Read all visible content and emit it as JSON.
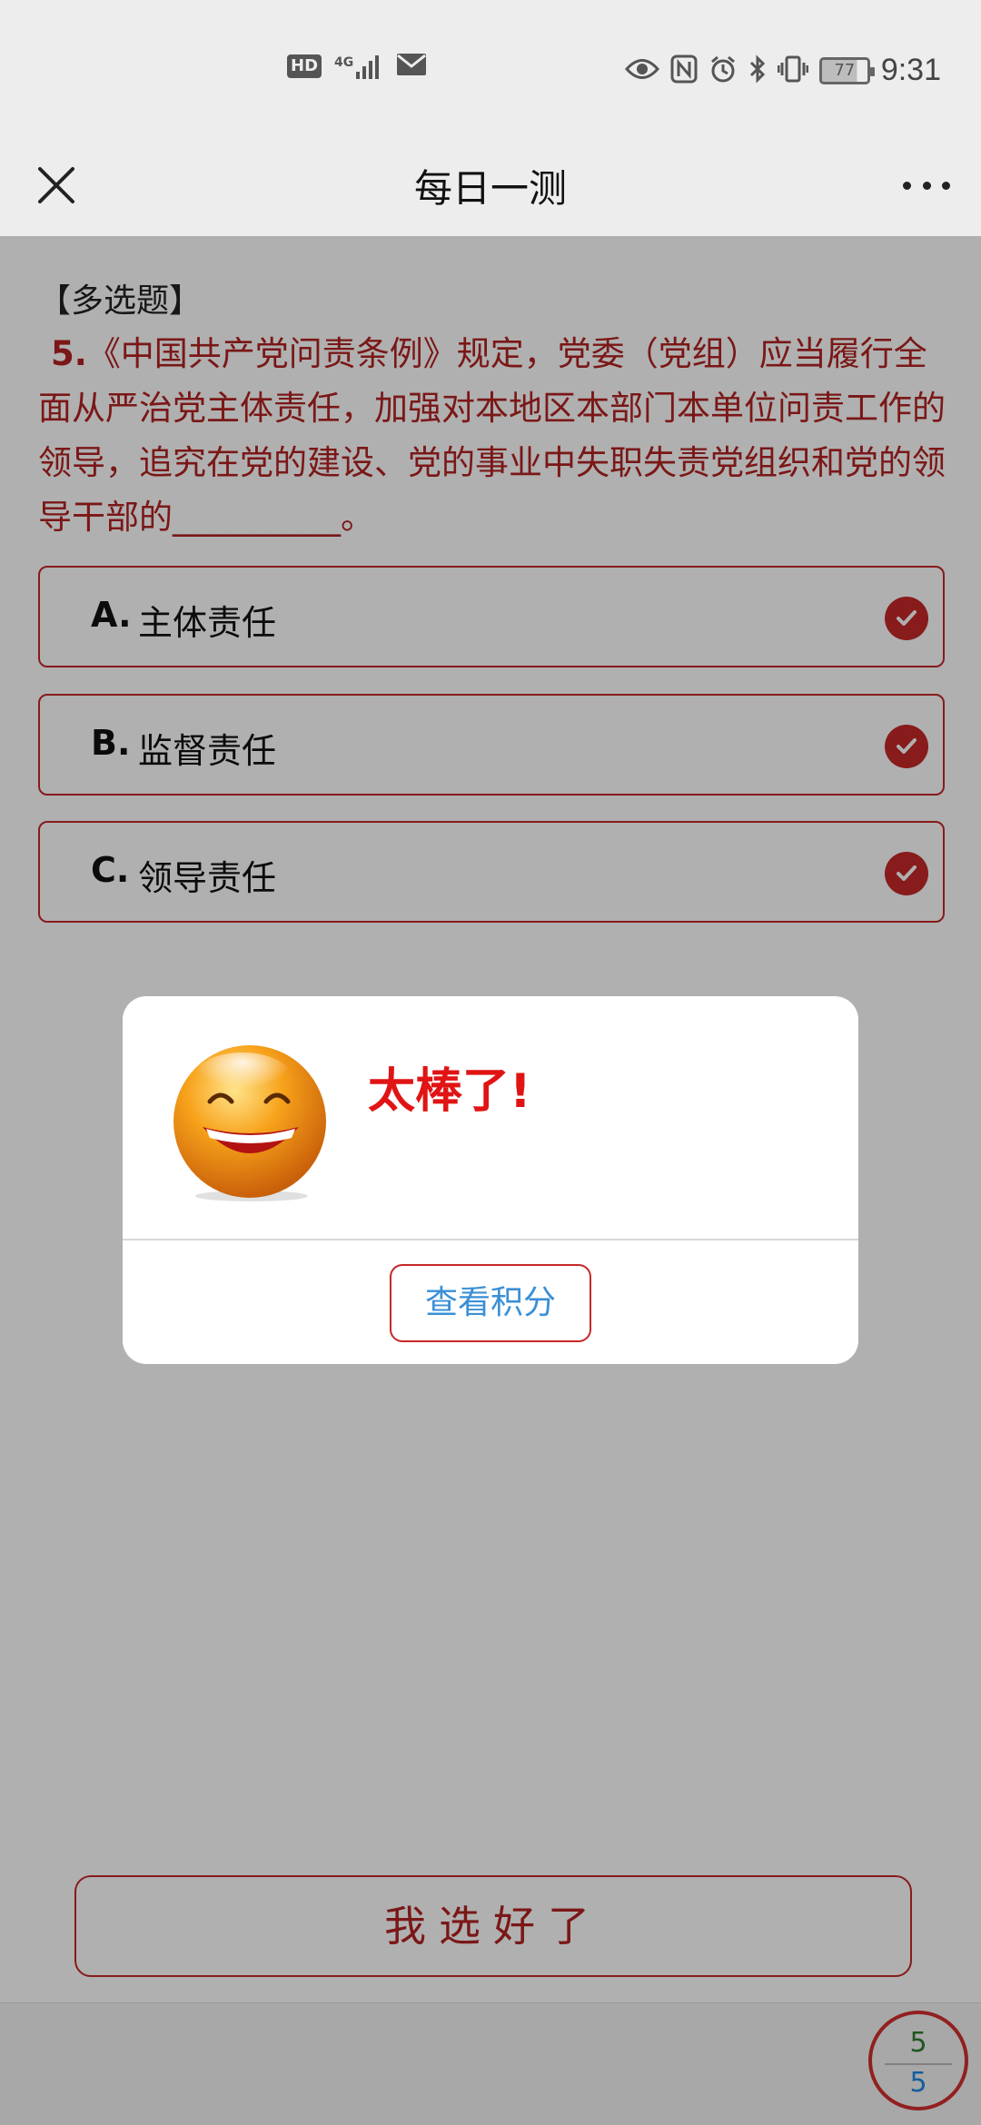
{
  "status_bar": {
    "left_icons": [
      "hd-icon",
      "signal-4g-icon",
      "mail-icon"
    ],
    "hd_label": "HD",
    "network_label": "4G",
    "right_icons": [
      "eye-icon",
      "nfc-icon",
      "alarm-icon",
      "bluetooth-icon",
      "vibrate-icon",
      "battery-icon"
    ],
    "battery_level": "77",
    "time": "9:31"
  },
  "nav": {
    "title": "每日一测"
  },
  "question": {
    "type_label": "【多选题】",
    "number": "5.",
    "text": "《中国共产党问责条例》规定，党委（党组）应当履行全面从严治党主体责任，加强对本地区本部门本单位问责工作的领导，追究在党的建设、党的事业中失职失责党组织和党的领导干部的__________。"
  },
  "options": [
    {
      "letter": "A.",
      "text": "主体责任",
      "selected": true
    },
    {
      "letter": "B.",
      "text": "监督责任",
      "selected": true
    },
    {
      "letter": "C.",
      "text": "领导责任",
      "selected": true
    }
  ],
  "confirm_button": "我选好了",
  "progress": {
    "current": "5",
    "total": "5"
  },
  "modal": {
    "icon": "smiley-face-icon",
    "title": "太棒了!",
    "button": "查看积分"
  },
  "colors": {
    "accent_red": "#c62828",
    "title_red": "#e01414",
    "link_blue": "#3a8fd6",
    "overlay": "rgba(0,0,0,0.31)"
  }
}
